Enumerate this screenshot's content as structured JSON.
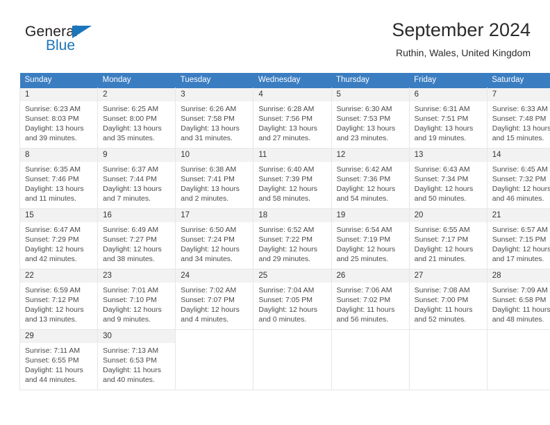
{
  "brand": {
    "name_top": "General",
    "name_bottom": "Blue"
  },
  "header": {
    "title": "September 2024",
    "subtitle": "Ruthin, Wales, United Kingdom"
  },
  "colors": {
    "header_blue": "#3b7dc1",
    "brand_blue": "#1b75bb",
    "daynum_bg": "#f2f2f2",
    "cell_border": "#e6e6e6",
    "text": "#4a4a4a"
  },
  "weekdays": [
    "Sunday",
    "Monday",
    "Tuesday",
    "Wednesday",
    "Thursday",
    "Friday",
    "Saturday"
  ],
  "weeks": [
    [
      {
        "day": "1",
        "sunrise": "Sunrise: 6:23 AM",
        "sunset": "Sunset: 8:03 PM",
        "daylight": "Daylight: 13 hours and 39 minutes."
      },
      {
        "day": "2",
        "sunrise": "Sunrise: 6:25 AM",
        "sunset": "Sunset: 8:00 PM",
        "daylight": "Daylight: 13 hours and 35 minutes."
      },
      {
        "day": "3",
        "sunrise": "Sunrise: 6:26 AM",
        "sunset": "Sunset: 7:58 PM",
        "daylight": "Daylight: 13 hours and 31 minutes."
      },
      {
        "day": "4",
        "sunrise": "Sunrise: 6:28 AM",
        "sunset": "Sunset: 7:56 PM",
        "daylight": "Daylight: 13 hours and 27 minutes."
      },
      {
        "day": "5",
        "sunrise": "Sunrise: 6:30 AM",
        "sunset": "Sunset: 7:53 PM",
        "daylight": "Daylight: 13 hours and 23 minutes."
      },
      {
        "day": "6",
        "sunrise": "Sunrise: 6:31 AM",
        "sunset": "Sunset: 7:51 PM",
        "daylight": "Daylight: 13 hours and 19 minutes."
      },
      {
        "day": "7",
        "sunrise": "Sunrise: 6:33 AM",
        "sunset": "Sunset: 7:48 PM",
        "daylight": "Daylight: 13 hours and 15 minutes."
      }
    ],
    [
      {
        "day": "8",
        "sunrise": "Sunrise: 6:35 AM",
        "sunset": "Sunset: 7:46 PM",
        "daylight": "Daylight: 13 hours and 11 minutes."
      },
      {
        "day": "9",
        "sunrise": "Sunrise: 6:37 AM",
        "sunset": "Sunset: 7:44 PM",
        "daylight": "Daylight: 13 hours and 7 minutes."
      },
      {
        "day": "10",
        "sunrise": "Sunrise: 6:38 AM",
        "sunset": "Sunset: 7:41 PM",
        "daylight": "Daylight: 13 hours and 2 minutes."
      },
      {
        "day": "11",
        "sunrise": "Sunrise: 6:40 AM",
        "sunset": "Sunset: 7:39 PM",
        "daylight": "Daylight: 12 hours and 58 minutes."
      },
      {
        "day": "12",
        "sunrise": "Sunrise: 6:42 AM",
        "sunset": "Sunset: 7:36 PM",
        "daylight": "Daylight: 12 hours and 54 minutes."
      },
      {
        "day": "13",
        "sunrise": "Sunrise: 6:43 AM",
        "sunset": "Sunset: 7:34 PM",
        "daylight": "Daylight: 12 hours and 50 minutes."
      },
      {
        "day": "14",
        "sunrise": "Sunrise: 6:45 AM",
        "sunset": "Sunset: 7:32 PM",
        "daylight": "Daylight: 12 hours and 46 minutes."
      }
    ],
    [
      {
        "day": "15",
        "sunrise": "Sunrise: 6:47 AM",
        "sunset": "Sunset: 7:29 PM",
        "daylight": "Daylight: 12 hours and 42 minutes."
      },
      {
        "day": "16",
        "sunrise": "Sunrise: 6:49 AM",
        "sunset": "Sunset: 7:27 PM",
        "daylight": "Daylight: 12 hours and 38 minutes."
      },
      {
        "day": "17",
        "sunrise": "Sunrise: 6:50 AM",
        "sunset": "Sunset: 7:24 PM",
        "daylight": "Daylight: 12 hours and 34 minutes."
      },
      {
        "day": "18",
        "sunrise": "Sunrise: 6:52 AM",
        "sunset": "Sunset: 7:22 PM",
        "daylight": "Daylight: 12 hours and 29 minutes."
      },
      {
        "day": "19",
        "sunrise": "Sunrise: 6:54 AM",
        "sunset": "Sunset: 7:19 PM",
        "daylight": "Daylight: 12 hours and 25 minutes."
      },
      {
        "day": "20",
        "sunrise": "Sunrise: 6:55 AM",
        "sunset": "Sunset: 7:17 PM",
        "daylight": "Daylight: 12 hours and 21 minutes."
      },
      {
        "day": "21",
        "sunrise": "Sunrise: 6:57 AM",
        "sunset": "Sunset: 7:15 PM",
        "daylight": "Daylight: 12 hours and 17 minutes."
      }
    ],
    [
      {
        "day": "22",
        "sunrise": "Sunrise: 6:59 AM",
        "sunset": "Sunset: 7:12 PM",
        "daylight": "Daylight: 12 hours and 13 minutes."
      },
      {
        "day": "23",
        "sunrise": "Sunrise: 7:01 AM",
        "sunset": "Sunset: 7:10 PM",
        "daylight": "Daylight: 12 hours and 9 minutes."
      },
      {
        "day": "24",
        "sunrise": "Sunrise: 7:02 AM",
        "sunset": "Sunset: 7:07 PM",
        "daylight": "Daylight: 12 hours and 4 minutes."
      },
      {
        "day": "25",
        "sunrise": "Sunrise: 7:04 AM",
        "sunset": "Sunset: 7:05 PM",
        "daylight": "Daylight: 12 hours and 0 minutes."
      },
      {
        "day": "26",
        "sunrise": "Sunrise: 7:06 AM",
        "sunset": "Sunset: 7:02 PM",
        "daylight": "Daylight: 11 hours and 56 minutes."
      },
      {
        "day": "27",
        "sunrise": "Sunrise: 7:08 AM",
        "sunset": "Sunset: 7:00 PM",
        "daylight": "Daylight: 11 hours and 52 minutes."
      },
      {
        "day": "28",
        "sunrise": "Sunrise: 7:09 AM",
        "sunset": "Sunset: 6:58 PM",
        "daylight": "Daylight: 11 hours and 48 minutes."
      }
    ],
    [
      {
        "day": "29",
        "sunrise": "Sunrise: 7:11 AM",
        "sunset": "Sunset: 6:55 PM",
        "daylight": "Daylight: 11 hours and 44 minutes."
      },
      {
        "day": "30",
        "sunrise": "Sunrise: 7:13 AM",
        "sunset": "Sunset: 6:53 PM",
        "daylight": "Daylight: 11 hours and 40 minutes."
      },
      {
        "day": "",
        "sunrise": "",
        "sunset": "",
        "daylight": ""
      },
      {
        "day": "",
        "sunrise": "",
        "sunset": "",
        "daylight": ""
      },
      {
        "day": "",
        "sunrise": "",
        "sunset": "",
        "daylight": ""
      },
      {
        "day": "",
        "sunrise": "",
        "sunset": "",
        "daylight": ""
      },
      {
        "day": "",
        "sunrise": "",
        "sunset": "",
        "daylight": ""
      }
    ]
  ]
}
